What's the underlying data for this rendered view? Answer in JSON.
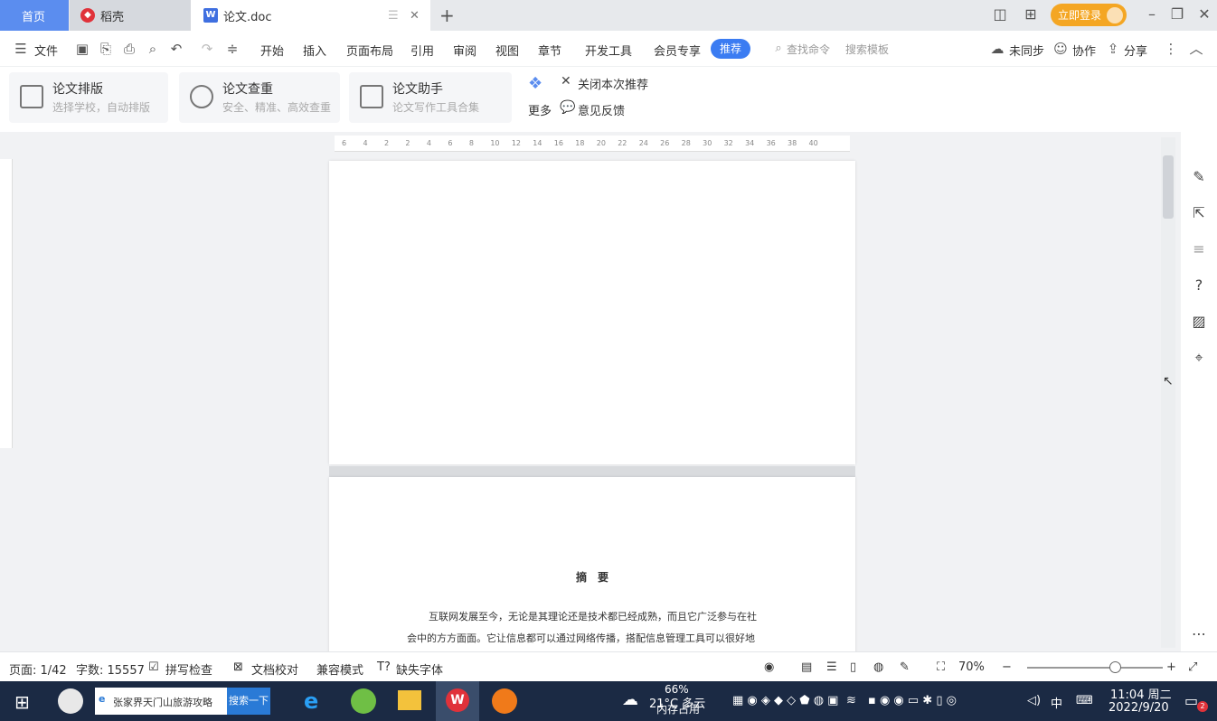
{
  "tabs": {
    "home": "首页",
    "daoke": "稻壳",
    "doc": "论文.doc",
    "login": "立即登录"
  },
  "menu": {
    "file": "文件",
    "items": [
      "开始",
      "插入",
      "页面布局",
      "引用",
      "审阅",
      "视图",
      "章节",
      "开发工具",
      "会员专享"
    ],
    "recommend": "推荐",
    "find_command": "查找命令",
    "search_template": "搜索模板",
    "unsync": "未同步",
    "collab": "协作",
    "share": "分享"
  },
  "ribbon": {
    "cards": [
      {
        "title": "论文排版",
        "sub": "选择学校，自动排版"
      },
      {
        "title": "论文查重",
        "sub": "安全、精准、高效查重"
      },
      {
        "title": "论文助手",
        "sub": "论文写作工具合集"
      }
    ],
    "close_recommend": "关闭本次推荐",
    "more": "更多",
    "feedback": "意见反馈"
  },
  "ruler_numbers": [
    "6",
    "4",
    "2",
    "2",
    "4",
    "6",
    "8",
    "10",
    "12",
    "14",
    "16",
    "18",
    "20",
    "22",
    "24",
    "26",
    "28",
    "30",
    "32",
    "34",
    "36",
    "38",
    "40"
  ],
  "document": {
    "abstract_heading": "摘　要",
    "line1": "互联网发展至今，无论是其理论还是技术都已经成熟，而且它广泛参与在社",
    "line2": "会中的方方面面。它让信息都可以通过网络传播，搭配信息管理工具可以很好地"
  },
  "status": {
    "page": "页面: 1/42",
    "words": "字数: 15557",
    "spell": "拼写检查",
    "doc_check": "文档校对",
    "compat": "兼容模式",
    "missing_font": "缺失字体",
    "zoom": "70%",
    "zoom_fraction": 0.7
  },
  "taskbar": {
    "search_text": "张家界天门山旅游攻略",
    "search_btn": "搜索一下",
    "weather": "21°C 多云",
    "memory_pct": "66%",
    "memory_label": "内存占用",
    "ime": "中",
    "time": "11:04 周二",
    "date": "2022/9/20",
    "notify_count": "2"
  }
}
